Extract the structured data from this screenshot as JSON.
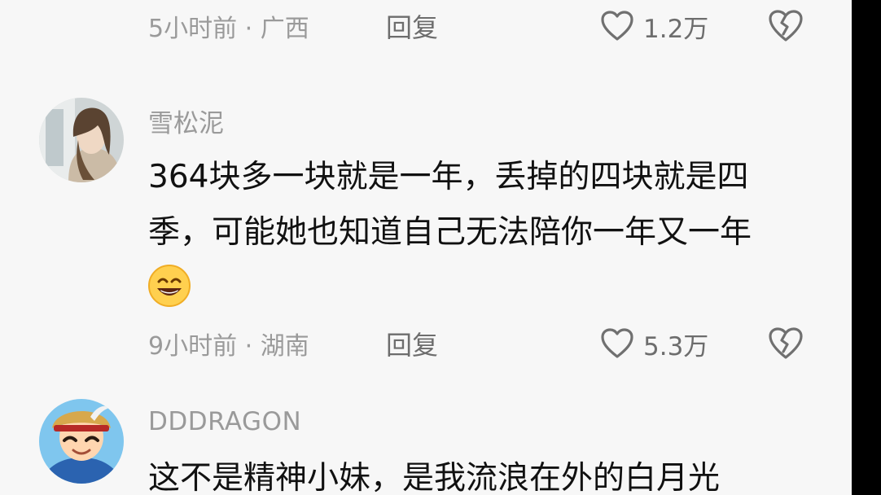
{
  "comments": [
    {
      "time_location": "5小时前 · 广西",
      "reply_label": "回复",
      "like_count": "1.2万"
    },
    {
      "username": "雪松泥",
      "text_line_1": "364块多一块就是一年，丢掉的四块就是四",
      "text_line_2": "季，可能她也知道自己无法陪你一年又一年",
      "emoji_icon": "grinning-face-emoji",
      "time_location": "9小时前 · 湖南",
      "reply_label": "回复",
      "like_count": "5.3万"
    },
    {
      "username": "DDDRAGON",
      "text_line_1": "这不是精神小妹，是我流浪在外的白月光"
    }
  ],
  "icons": {
    "like": "heart-outline-icon",
    "dislike": "broken-heart-icon"
  },
  "colors": {
    "background": "#f7f7f7",
    "text": "#111111",
    "muted": "#9a9a9a",
    "icon": "#6d6d6d",
    "edge": "#000000"
  }
}
